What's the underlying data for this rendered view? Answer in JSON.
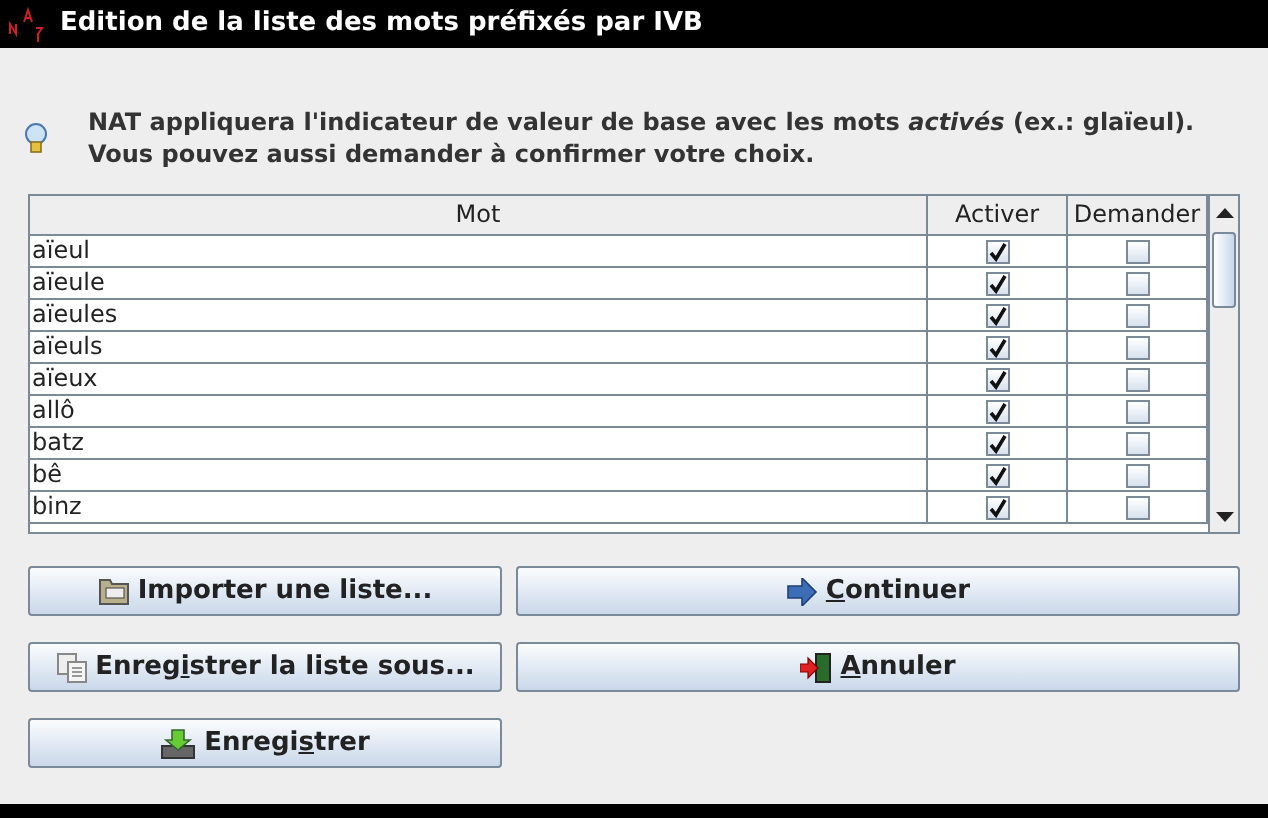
{
  "window": {
    "title": "Edition de la liste des mots préfixés par IVB"
  },
  "info": {
    "text": "NAT appliquera l'indicateur de valeur de base avec les mots *activés* (ex.: glaïeul).\nVous pouvez aussi demander à confirmer votre choix."
  },
  "table": {
    "columns": [
      "Mot",
      "Activer",
      "Demander"
    ],
    "rows": [
      {
        "word": "aïeul",
        "activate": true,
        "ask": false
      },
      {
        "word": "aïeule",
        "activate": true,
        "ask": false
      },
      {
        "word": "aïeules",
        "activate": true,
        "ask": false
      },
      {
        "word": "aïeuls",
        "activate": true,
        "ask": false
      },
      {
        "word": "aïeux",
        "activate": true,
        "ask": false
      },
      {
        "word": "allô",
        "activate": true,
        "ask": false
      },
      {
        "word": "batz",
        "activate": true,
        "ask": false
      },
      {
        "word": "bê",
        "activate": true,
        "ask": false
      },
      {
        "word": "binz",
        "activate": true,
        "ask": false
      }
    ]
  },
  "buttons": [
    {
      "kind": "import",
      "before": "Importer une liste..."
    },
    {
      "kind": "continue",
      "key": "C",
      "after": "ontinuer"
    },
    {
      "kind": "saveas",
      "before": "Enreg",
      "key": "i",
      "after": "strer la liste sous..."
    },
    {
      "kind": "cancel",
      "key": "A",
      "after": "nnuler"
    },
    {
      "kind": "save",
      "before": "Enregi",
      "key": "s",
      "after": "trer"
    }
  ]
}
